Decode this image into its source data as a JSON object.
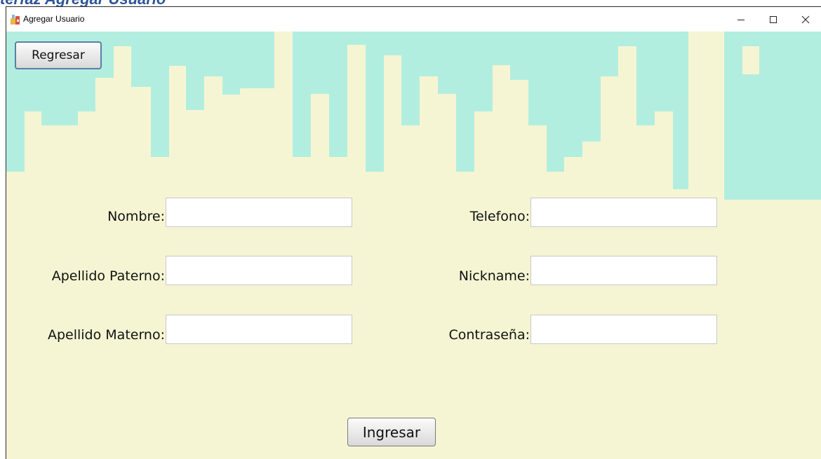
{
  "doc_heading": "terfaz Agregar Usuario",
  "window": {
    "title": "Agregar Usuario",
    "icon": "app-icon",
    "controls": {
      "minimize": "minimize-icon",
      "maximize": "maximize-icon",
      "close": "close-icon"
    }
  },
  "buttons": {
    "back_label": "Regresar",
    "submit_label": "Ingresar"
  },
  "form": {
    "nombre_label": "Nombre:",
    "apellido_paterno_label": "Apellido Paterno:",
    "apellido_materno_label": "Apellido Materno:",
    "telefono_label": "Telefono:",
    "nickname_label": "Nickname:",
    "contrasena_label": "Contraseña:",
    "nombre_value": "",
    "apellido_paterno_value": "",
    "apellido_materno_value": "",
    "telefono_value": "",
    "nickname_value": "",
    "contrasena_value": ""
  },
  "colors": {
    "background": "#f6f5d3",
    "skyline": "#b2eedf",
    "heading": "#2f5597"
  }
}
